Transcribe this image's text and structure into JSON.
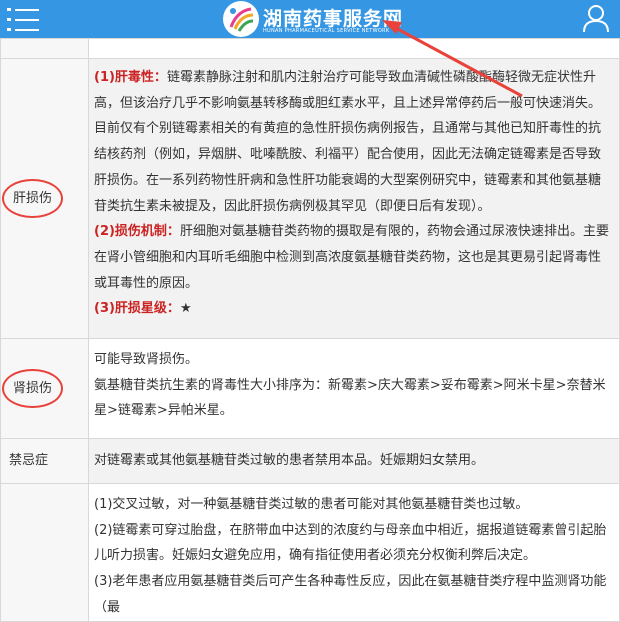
{
  "header": {
    "site_title": "湖南药事服务网",
    "site_subtitle": "HUNAN PHARMACEUTICAL SERVICE NETWORK",
    "bg_color": "#3596e3",
    "icons": [
      "menu-icon",
      "user-icon"
    ]
  },
  "annotation": {
    "arrow_color": "#e8423b",
    "circle_color": "#e8423b"
  },
  "rows": [
    {
      "label": "",
      "paragraphs": []
    },
    {
      "label": "肝损伤",
      "items": [
        {
          "heading": "(1)肝毒性：",
          "text": "链霉素静脉注射和肌内注射治疗可能导致血清碱性磷酸酯酶轻微无症状性升高，但该治疗几乎不影响氨基转移酶或胆红素水平，且上述异常停药后一般可快速消失。目前仅有个别链霉素相关的有黄疸的急性肝损伤病例报告，且通常与其他已知肝毒性的抗结核药剂（例如，异烟肼、吡嗪酰胺、利福平）配合使用，因此无法确定链霉素是否导致肝损伤。在一系列药物性肝病和急性肝功能衰竭的大型案例研究中，链霉素和其他氨基糖苷类抗生素未被提及，因此肝损伤病例极其罕见（即便日后有发现）。"
        },
        {
          "heading": "(2)损伤机制：",
          "text": "肝细胞对氨基糖苷类药物的摄取是有限的，药物会通过尿液快速排出。主要在肾小管细胞和内耳听毛细胞中检测到高浓度氨基糖苷类药物，这也是其更易引起肾毒性或耳毒性的原因。"
        },
        {
          "heading": "(3)肝损星级：",
          "text": "★"
        }
      ]
    },
    {
      "label": "肾损伤",
      "paragraphs": [
        "可能导致肾损伤。",
        "氨基糖苷类抗生素的肾毒性大小排序为：新霉素>庆大霉素>妥布霉素>阿米卡星>奈替米星>链霉素>异帕米星。"
      ]
    },
    {
      "label": "禁忌症",
      "paragraphs": [
        "对链霉素或其他氨基糖苷类过敏的患者禁用本品。妊娠期妇女禁用。"
      ]
    },
    {
      "label": "",
      "paragraphs": [
        "(1)交叉过敏，对一种氨基糖苷类过敏的患者可能对其他氨基糖苷类也过敏。",
        "(2)链霉素可穿过胎盘，在脐带血中达到的浓度约与母亲血中相近，据报道链霉素曾引起胎儿听力损害。妊娠妇女避免应用，确有指征使用者必须充分权衡利弊后决定。",
        "(3)老年患者应用氨基糖苷类后可产生各种毒性反应，因此在氨基糖苷类疗程中监测肾功能（最"
      ]
    }
  ]
}
